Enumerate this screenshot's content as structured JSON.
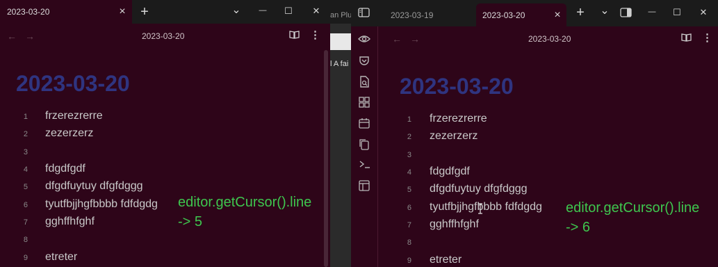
{
  "left_window": {
    "tab_title": "2023-03-20",
    "tab_close": "×",
    "new_tab": "+",
    "chevron": "⌄",
    "minimize": "—",
    "maximize": "☐",
    "close": "✕",
    "nav_back": "←",
    "nav_forward": "→",
    "note_title": "2023-03-20",
    "heading": "2023-03-20",
    "lines": [
      {
        "num": "1",
        "text": "frzerezrerre"
      },
      {
        "num": "2",
        "text": "zezerzerz"
      },
      {
        "num": "3",
        "text": ""
      },
      {
        "num": "4",
        "text": "fdgdfgdf"
      },
      {
        "num": "5",
        "text": "dfgdfuytuy dfgfdggg"
      },
      {
        "num": "6",
        "text": "tyutfbjjhgfbbbb fdfdgdg"
      },
      {
        "num": "7",
        "text": "gghffhfghf"
      },
      {
        "num": "8",
        "text": ""
      },
      {
        "num": "9",
        "text": "etreter"
      }
    ],
    "annotation_line1": "editor.getCursor().line",
    "annotation_line2": "-> 5"
  },
  "middle_strip": {
    "text_top": "an Plu",
    "text_mid": "l A fai"
  },
  "right_window": {
    "tabs": [
      {
        "title": "2023-03-19"
      },
      {
        "title": "2023-03-20",
        "active": true
      }
    ],
    "tab_close": "×",
    "new_tab": "+",
    "chevron": "⌄",
    "minimize": "—",
    "maximize": "☐",
    "close": "✕",
    "nav_back": "←",
    "nav_forward": "→",
    "note_title": "2023-03-20",
    "heading": "2023-03-20",
    "lines": [
      {
        "num": "1",
        "text": "frzerezrerre"
      },
      {
        "num": "2",
        "text": "zezerzerz"
      },
      {
        "num": "3",
        "text": ""
      },
      {
        "num": "4",
        "text": "fdgdfgdf"
      },
      {
        "num": "5",
        "text": "dfgdfuytuy dfgfdggg"
      },
      {
        "num": "6",
        "text": "tyutfbjjhgfbbbb fdfdgdg"
      },
      {
        "num": "7",
        "text": "gghffhfghf"
      },
      {
        "num": "8",
        "text": ""
      },
      {
        "num": "9",
        "text": "etreter"
      }
    ],
    "annotation_line1": "editor.getCursor().line",
    "annotation_line2": "-> 6",
    "ribbon_icons": [
      "eye-icon",
      "pocket-icon",
      "file-search-icon",
      "grid-icon",
      "calendar-icon",
      "copy-icon",
      "terminal-icon",
      "layout-icon"
    ]
  },
  "colors": {
    "editor_bg": "#2e0519",
    "tabbar_bg": "#1b1b1b",
    "heading": "#2f3480",
    "annotation": "#3ec64e",
    "text": "#c9c9c9"
  }
}
